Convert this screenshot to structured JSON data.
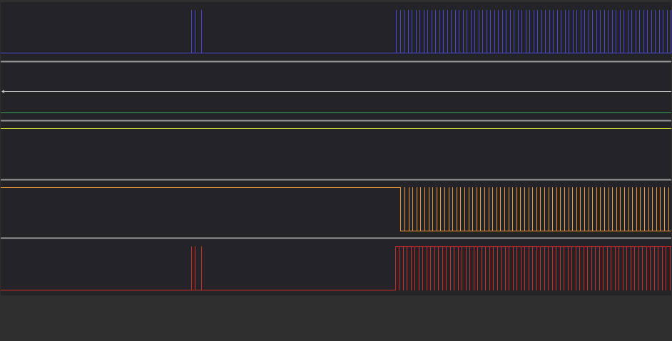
{
  "viewer": {
    "colors": {
      "background": "#2f2f2f",
      "plot_background": "#232328",
      "separator": "#9a9a9a",
      "marker_line": "#bdbdbd",
      "channel_1": "#4a46d6",
      "channel_green": "#3aa84f",
      "channel_yellow": "#c7c52a",
      "channel_orange": "#ef9a32",
      "channel_red": "#d62a2a"
    },
    "channels": [
      {
        "id": "ch1",
        "color_key": "channel_1",
        "burst1_pulses": 3,
        "burst2_pulses": 70
      },
      {
        "id": "ch2",
        "color_key": "channel_green"
      },
      {
        "id": "ch3",
        "color_key": "channel_yellow"
      },
      {
        "id": "ch4",
        "color_key": "channel_orange",
        "burst2_pulses": 70
      },
      {
        "id": "ch5",
        "color_key": "channel_red",
        "burst1_pulses": 3,
        "burst2_pulses": 70
      }
    ]
  }
}
